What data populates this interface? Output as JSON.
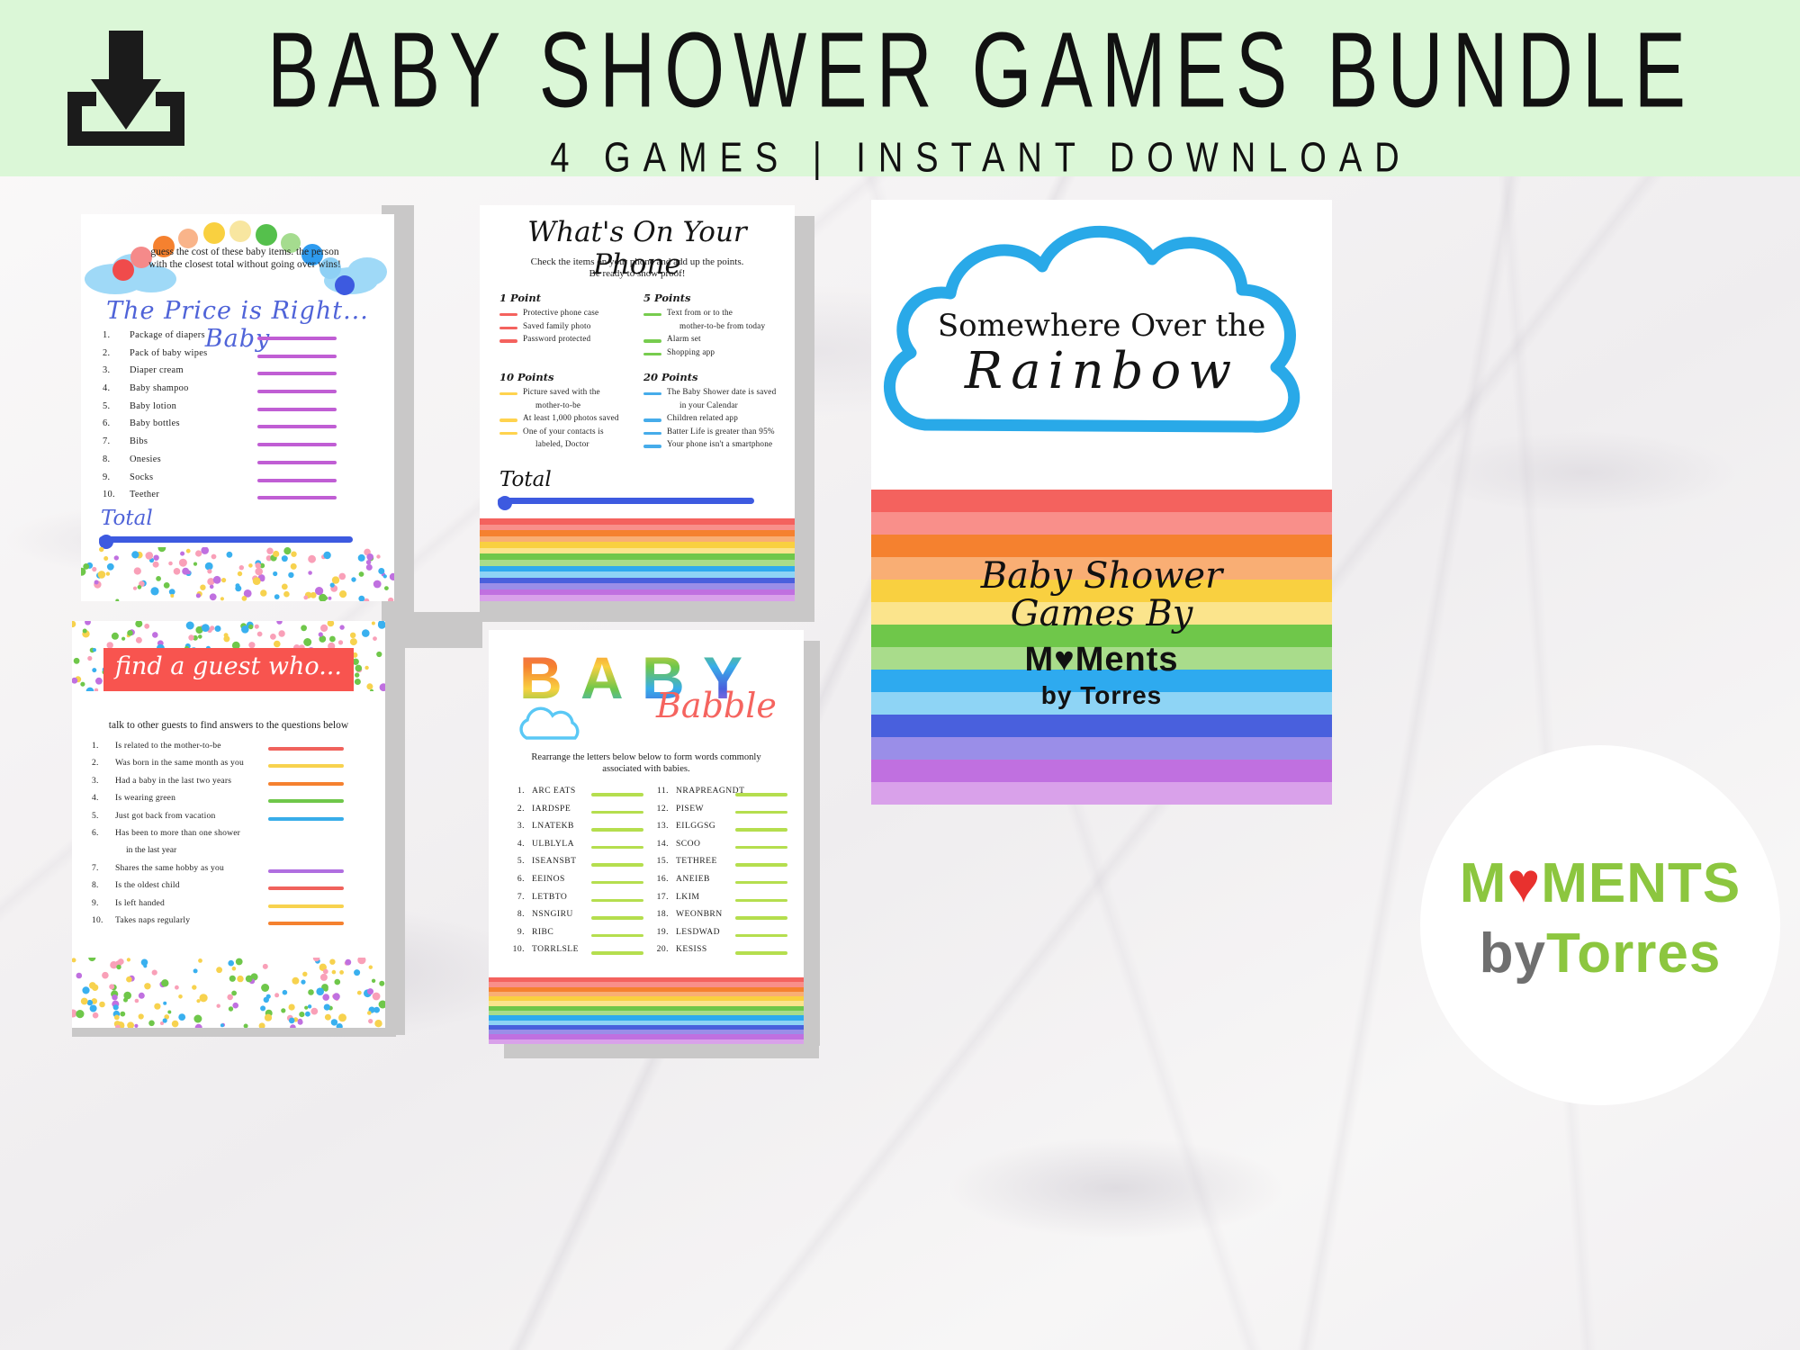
{
  "header": {
    "title": "BABY SHOWER GAMES BUNDLE",
    "subtitle": "4 GAMES | INSTANT DOWNLOAD",
    "icon": "download-icon",
    "bg_color": "#dbf7d7"
  },
  "price_is_right": {
    "intro": "guess the cost of these baby items. the person with the closest total without going over wins!",
    "title": "The Price is Right... Baby",
    "items": [
      {
        "num": "1.",
        "label": "Package of diapers"
      },
      {
        "num": "2.",
        "label": "Pack of baby wipes"
      },
      {
        "num": "3.",
        "label": "Diaper cream"
      },
      {
        "num": "4.",
        "label": "Baby shampoo"
      },
      {
        "num": "5.",
        "label": "Baby lotion"
      },
      {
        "num": "6.",
        "label": "Baby bottles"
      },
      {
        "num": "7.",
        "label": "Bibs"
      },
      {
        "num": "8.",
        "label": "Onesies"
      },
      {
        "num": "9.",
        "label": "Socks"
      },
      {
        "num": "10.",
        "label": "Teether"
      }
    ],
    "total_label": "Total",
    "rule_color": "#c05ed4",
    "total_color": "#3d5ae0",
    "rainbow_dot_colors": [
      "#f04b4b",
      "#f58a8a",
      "#f5812f",
      "#f9b48a",
      "#f9d040",
      "#f8e6a0",
      "#55c04c",
      "#a5dc8f",
      "#2e9bef",
      "#8ed0f5",
      "#3d5ae0"
    ]
  },
  "whats_on_phone": {
    "title": "What's On Your Phone",
    "subtitle": "Check the items on your phone and add up the points. Be ready to show proof!",
    "groups": [
      {
        "heading": "1 Point",
        "color": "#f4625e",
        "items": [
          "Protective phone case",
          "Saved family photo",
          "Password protected"
        ]
      },
      {
        "heading": "5 Points",
        "color": "#77cc4e",
        "items": [
          "Text from or to the",
          "mother-to-be from today",
          "Alarm set",
          "Shopping app"
        ],
        "continuations": [
          1
        ]
      },
      {
        "heading": "10 Points",
        "color": "#ffd34e",
        "items": [
          "Picture saved with the",
          "mother-to-be",
          "At least 1,000 photos saved",
          "One of your contacts is",
          "labeled, Doctor"
        ],
        "continuations": [
          1,
          4
        ]
      },
      {
        "heading": "20 Points",
        "color": "#46acea",
        "items": [
          "The Baby Shower date is saved",
          "in your Calendar",
          "Children related app",
          "Batter Life is greater than 95%",
          "Your phone isn't a smartphone"
        ],
        "continuations": [
          1
        ]
      }
    ],
    "total_label": "Total",
    "total_color": "#3d5ae0",
    "stripe_colors": [
      "#f4625e",
      "#f98f8a",
      "#f5812f",
      "#f9ae74",
      "#f9d040",
      "#fbe48c",
      "#6fc74a",
      "#a9dc8b",
      "#2eaaef",
      "#8ed4f5",
      "#4960dd",
      "#9a8ee8",
      "#c070e0",
      "#d9a1ea"
    ]
  },
  "find_a_guest": {
    "banner": "find a guest who...",
    "subtitle": "talk to other guests to find answers to the questions below",
    "items": [
      {
        "num": "1.",
        "label": "Is related to the mother-to-be",
        "cont": "",
        "color": "#f0625c"
      },
      {
        "num": "2.",
        "label": "Was born in the same month as you",
        "cont": "",
        "color": "#f7d24e"
      },
      {
        "num": "3.",
        "label": "Had a baby in the last two years",
        "cont": "",
        "color": "#f5812f"
      },
      {
        "num": "4.",
        "label": "Is wearing green",
        "cont": "",
        "color": "#6fc74a"
      },
      {
        "num": "5.",
        "label": "Just got back from vacation",
        "cont": "",
        "color": "#38ade9"
      },
      {
        "num": "6.",
        "label": "Has been to more than one shower",
        "cont": "in the last year",
        "color": "#4960dd"
      },
      {
        "num": "7.",
        "label": "Shares the same hobby as you",
        "cont": "",
        "color": "#b06ee0"
      },
      {
        "num": "8.",
        "label": "Is the oldest child",
        "cont": "",
        "color": "#f0625c"
      },
      {
        "num": "9.",
        "label": "Is left handed",
        "cont": "",
        "color": "#f7d24e"
      },
      {
        "num": "10.",
        "label": "Takes naps regularly",
        "cont": "",
        "color": "#f5812f"
      }
    ],
    "banner_color": "#f8544f",
    "confetti_colors": [
      "#39b0ef",
      "#6fc74a",
      "#f7d24e",
      "#c070e0",
      "#f9a0b8"
    ]
  },
  "baby_babble": {
    "title": "BABY",
    "title_letters": [
      {
        "ch": "B",
        "colors": [
          "#f0625c",
          "#f5812f",
          "#f9d040",
          "#6fc74a"
        ]
      },
      {
        "ch": "A",
        "colors": [
          "#f5812f",
          "#f9d040",
          "#6fc74a",
          "#38ade9"
        ]
      },
      {
        "ch": "B",
        "colors": [
          "#f9d040",
          "#6fc74a",
          "#38ade9",
          "#4960dd"
        ]
      },
      {
        "ch": "Y",
        "colors": [
          "#6fc74a",
          "#38ade9",
          "#4960dd",
          "#b06ee0"
        ]
      }
    ],
    "subtitle_word": "Babble",
    "subtitle": "Rearrange the letters below below to form words commonly associated with babies.",
    "rule_color": "#b5de4e",
    "cloud_color": "#5ac8f5",
    "words_left": [
      {
        "num": "1.",
        "label": "ARC EATS"
      },
      {
        "num": "2.",
        "label": "IARDSPE"
      },
      {
        "num": "3.",
        "label": "LNATEKB"
      },
      {
        "num": "4.",
        "label": "ULBLYLA"
      },
      {
        "num": "5.",
        "label": "ISEANSBT"
      },
      {
        "num": "6.",
        "label": "EEINOS"
      },
      {
        "num": "7.",
        "label": "LETBTO"
      },
      {
        "num": "8.",
        "label": "NSNGIRU"
      },
      {
        "num": "9.",
        "label": "RIBC"
      },
      {
        "num": "10.",
        "label": "TORRLSLE"
      }
    ],
    "words_right": [
      {
        "num": "11.",
        "label": "NRAPREAGNDT"
      },
      {
        "num": "12.",
        "label": "PISEW"
      },
      {
        "num": "13.",
        "label": "EILGGSG"
      },
      {
        "num": "14.",
        "label": "SCOO"
      },
      {
        "num": "15.",
        "label": "TETHREE"
      },
      {
        "num": "16.",
        "label": "ANEIEB"
      },
      {
        "num": "17.",
        "label": "LKIM"
      },
      {
        "num": "18.",
        "label": "WEONBRN"
      },
      {
        "num": "19.",
        "label": "LESDWAD"
      },
      {
        "num": "20.",
        "label": "KESISS"
      }
    ],
    "stripe_colors": [
      "#f4625e",
      "#f98f8a",
      "#f5812f",
      "#f9ae74",
      "#f9d040",
      "#fbe48c",
      "#6fc74a",
      "#a9dc8b",
      "#2eaaef",
      "#8ed4f5",
      "#4960dd",
      "#9a8ee8",
      "#c070e0",
      "#d9a1ea"
    ]
  },
  "rainbow_card": {
    "line1": "Somewhere Over the",
    "line2": "Rainbow",
    "cloud_color": "#29a9e8",
    "brand_line1": "Baby Shower",
    "brand_line2": "Games By",
    "logo_main": "M♥Ments",
    "logo_sub": "by Torres",
    "stripe_colors": [
      "#f4625e",
      "#f98f8a",
      "#f5812f",
      "#f9ae74",
      "#f9d040",
      "#fbe48c",
      "#6fc74a",
      "#a9dc8b",
      "#2eaaef",
      "#8ed4f5",
      "#4960dd",
      "#9a8ee8",
      "#c070e0",
      "#d9a1ea"
    ]
  },
  "watermark": {
    "logo_m_left": "M",
    "logo_heart": "♥",
    "logo_m_right": "MENTS",
    "logo_by": "by",
    "logo_torres": "Torres",
    "green": "#8cc63f",
    "red": "#e8312e",
    "grey": "#6f6f6f"
  }
}
